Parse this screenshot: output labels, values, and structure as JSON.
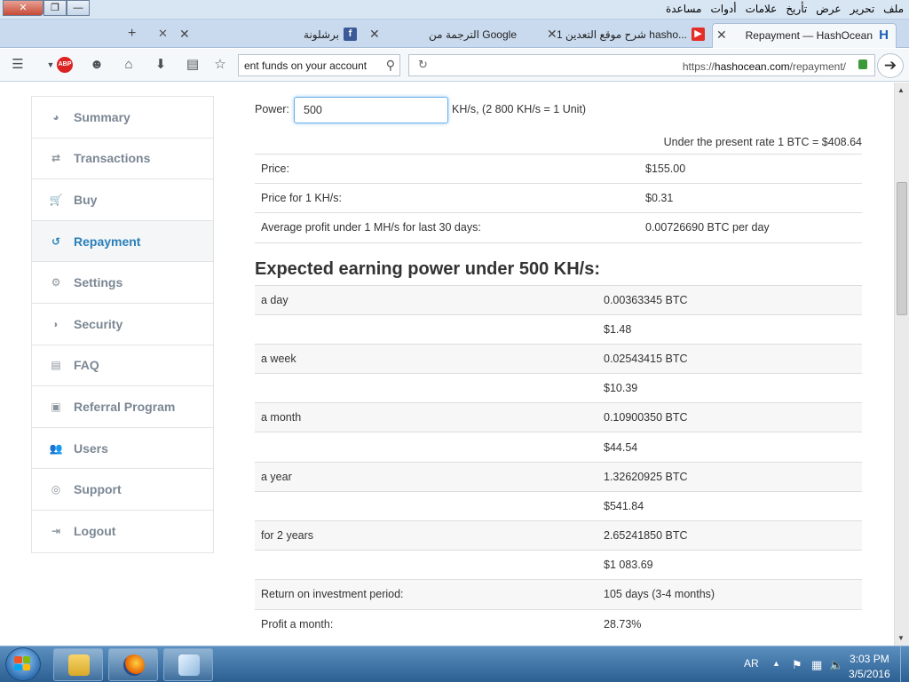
{
  "window": {
    "close_glyph": "✕",
    "max_glyph": "❐",
    "min_glyph": "—"
  },
  "menu": [
    "ملف",
    "تحرير",
    "عرض",
    "تأريخ",
    "علامات",
    "أدوات",
    "مساعدة"
  ],
  "tabs": {
    "active": {
      "title": "Repayment — HashOcean",
      "icon_letter": "H",
      "icon_color": "#1a5fb4"
    },
    "second": {
      "title": "1 شرح موقع التعدين hasho...",
      "icon_color": "#e52d27"
    },
    "third": {
      "title": "الترجمة من Google"
    },
    "fourth": {
      "title": "برشلونة",
      "icon_letter": "f",
      "icon_color": "#3b5998"
    },
    "close_glyph": "✕",
    "new_tab_glyph": "+"
  },
  "toolbar": {
    "menu_icon": "☰",
    "abp_label": "ABP",
    "search_value": "ent funds on your account",
    "url_prefix": "https://",
    "url_host": "hashocean.com",
    "url_path": "/repayment/",
    "go_glyph": "➔"
  },
  "sidebar": {
    "items": [
      {
        "label": "Summary",
        "icon": "◕"
      },
      {
        "label": "Transactions",
        "icon": "⇄"
      },
      {
        "label": "Buy",
        "icon": "🛒"
      },
      {
        "label": "Repayment",
        "icon": "↺"
      },
      {
        "label": "Settings",
        "icon": "⚙"
      },
      {
        "label": "Security",
        "icon": "◗"
      },
      {
        "label": "FAQ",
        "icon": "▤"
      },
      {
        "label": "Referral Program",
        "icon": "▣"
      },
      {
        "label": "Users",
        "icon": "👥"
      },
      {
        "label": "Support",
        "icon": "◎"
      },
      {
        "label": "Logout",
        "icon": "⇥"
      }
    ],
    "active_index": 3,
    "accent": "#2a7fb8"
  },
  "power": {
    "label": "Power:",
    "value": "500",
    "unit_text": "KH/s, (2 800 KH/s = 1 Unit)"
  },
  "rate_text": "Under the present rate 1 BTC = $408.64",
  "info_rows": [
    {
      "label": "Price:",
      "value": "$155.00"
    },
    {
      "label": "Price for 1 KH/s:",
      "value": "$0.31"
    },
    {
      "label": "Average profit under 1 MH/s for last 30 days:",
      "value": "0.00726690 BTC per day"
    }
  ],
  "earning_heading": "Expected earning power under 500 KH/s:",
  "earning_rows": [
    {
      "label": "a day",
      "value": "0.00363345 BTC"
    },
    {
      "label": "",
      "value": "$1.48"
    },
    {
      "label": "a week",
      "value": "0.02543415 BTC"
    },
    {
      "label": "",
      "value": "$10.39"
    },
    {
      "label": "a month",
      "value": "0.10900350 BTC"
    },
    {
      "label": "",
      "value": "$44.54"
    },
    {
      "label": "a year",
      "value": "1.32620925 BTC"
    },
    {
      "label": "",
      "value": "$541.84"
    },
    {
      "label": "for 2 years",
      "value": "2.65241850 BTC"
    },
    {
      "label": "",
      "value": "$1 083.69"
    },
    {
      "label": "Return on investment period:",
      "value": "105 days (3-4 months)"
    },
    {
      "label": "Profit a month:",
      "value": "28.73%"
    }
  ],
  "taskbar": {
    "lang": "AR",
    "time": "3:03 PM",
    "date": "3/5/2016"
  }
}
